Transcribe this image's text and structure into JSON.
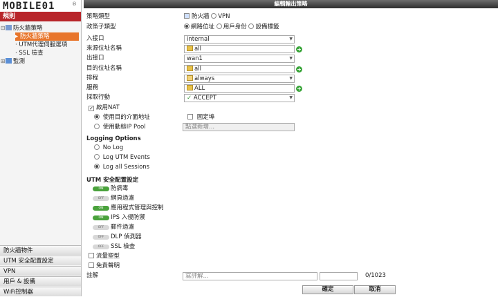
{
  "logo": {
    "text": "MOBILE01",
    "reg": "®"
  },
  "sidebar": {
    "header": "規則",
    "tree": [
      {
        "label": "防火牆策略"
      },
      {
        "label": "防火牆策略"
      },
      {
        "label": "UTM代理伺服選項"
      },
      {
        "label": "SSL 檢查"
      },
      {
        "label": "監測"
      }
    ],
    "accordion": [
      "防火牆物件",
      "UTM 安全配置設定",
      "VPN",
      "用戶 & 設備",
      "WiFi控制器"
    ]
  },
  "titlebar": "編輯輸出策略",
  "form": {
    "policy_type": {
      "label": "策略類型",
      "options": [
        "防火牆",
        "VPN"
      ]
    },
    "policy_subtype": {
      "label": "政策子類型",
      "options": [
        "網路位址",
        "用戶身份",
        "設備標籤"
      ]
    },
    "incoming": {
      "label": "入接口",
      "value": "internal"
    },
    "src_addr": {
      "label": "來源位址名稱",
      "value": "all"
    },
    "outgoing": {
      "label": "出接口",
      "value": "wan1"
    },
    "dst_addr": {
      "label": "目的位址名稱",
      "value": "all"
    },
    "schedule": {
      "label": "排程",
      "value": "always"
    },
    "service": {
      "label": "服務",
      "value": "ALL"
    },
    "action": {
      "label": "採取行動",
      "value": "ACCEPT"
    },
    "nat": {
      "label": "啟用NAT",
      "dest_iface": "使用目的介面地址",
      "fixed_port": "固定埠",
      "dynamic_pool": "使用動態IP Pool",
      "pool_placeholder": "點選新增..."
    },
    "logging": {
      "title": "Logging Options",
      "options": [
        "No Log",
        "Log UTM Events",
        "Log all Sessions"
      ]
    },
    "utm": {
      "title": "UTM 安全配置設定",
      "on_text": "ON",
      "off_text": "OFF",
      "items": [
        "防病毒",
        "網頁過濾",
        "應用程式管理與控制",
        "IPS 入侵防禦",
        "郵件過濾",
        "DLP 偵測器",
        "SSL 檢查"
      ]
    },
    "traffic_shaping": "流量塑型",
    "disclaimer": "免責聲明",
    "comment": {
      "label": "註解",
      "placeholder": "寫評解...",
      "counter": "0/1023"
    }
  },
  "buttons": {
    "ok": "確定",
    "cancel": "取消"
  },
  "colors": {
    "sidebar_header": "#b8252a",
    "selected": "#e8762c",
    "toggle_on": "#4aa23c",
    "add_icon": "#3aa53a"
  }
}
